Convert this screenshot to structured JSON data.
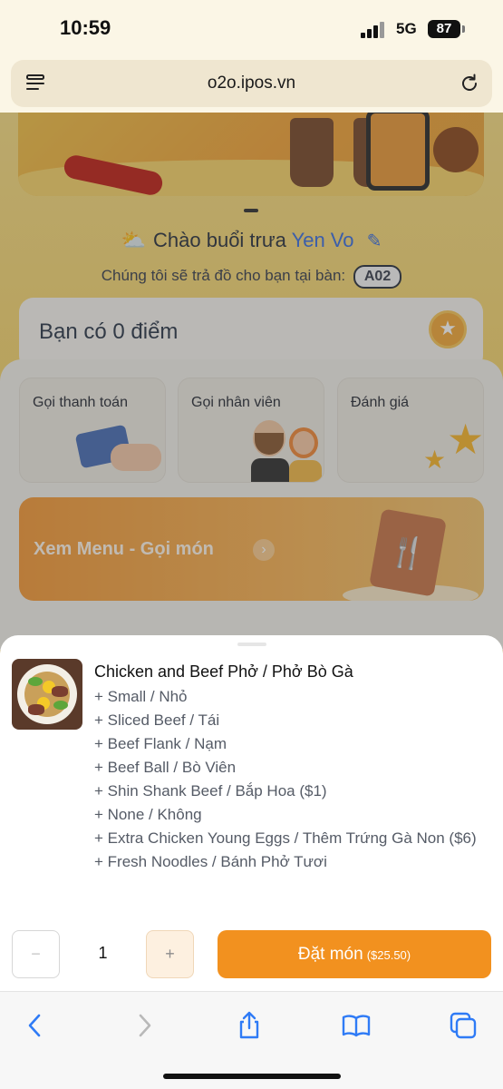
{
  "status_bar": {
    "time": "10:59",
    "network": "5G",
    "battery": "87"
  },
  "browser": {
    "url": "o2o.ipos.vn"
  },
  "greeting": {
    "text": "Chào buổi trưa",
    "name": "Yen Vo"
  },
  "table": {
    "text": "Chúng tôi sẽ trả đồ cho bạn tại bàn:",
    "number": "A02"
  },
  "points": {
    "label": "Bạn có 0 điểm"
  },
  "actions": [
    {
      "label": "Gọi thanh toán"
    },
    {
      "label": "Gọi nhân viên"
    },
    {
      "label": "Đánh giá"
    }
  ],
  "menu_button": {
    "label": "Xem Menu - Gọi món"
  },
  "sheet": {
    "dish_title": "Chicken and Beef Phở / Phở Bò Gà",
    "options": [
      "+ Small / Nhỏ",
      "+ Sliced Beef / Tái",
      "+ Beef Flank / Nạm",
      "+ Beef Ball / Bò Viên",
      "+ Shin Shank Beef / Bắp Hoa ($1)",
      "+ None / Không",
      "+ Extra Chicken Young Eggs / Thêm Trứng Gà Non ($6)",
      "+ Fresh Noodles / Bánh Phở Tươi"
    ],
    "quantity": "1",
    "minus_label": "−",
    "plus_label": "+",
    "order_label": "Đặt món",
    "order_price": "($25.50)"
  },
  "colors": {
    "accent": "#f2911f",
    "link": "#3b6fe0"
  }
}
